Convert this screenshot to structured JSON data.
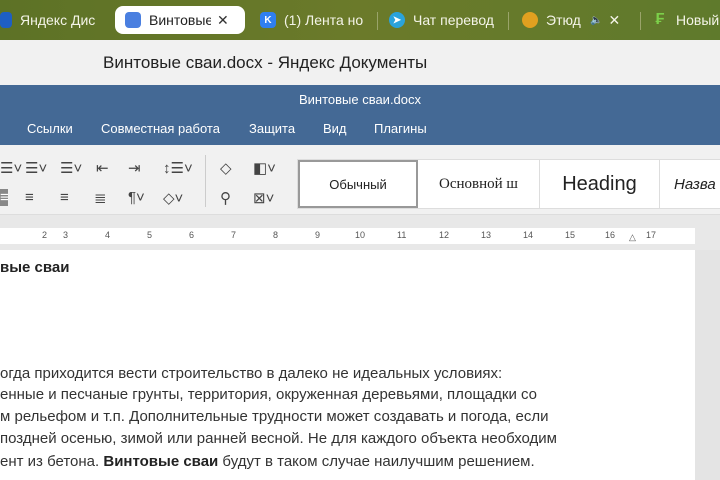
{
  "browser_tabs": [
    {
      "label": "Яндекс Дис",
      "icon": "yandex-disk-icon"
    },
    {
      "label": "Винтовые",
      "icon": "yandex-docs-icon",
      "active": true
    },
    {
      "label": "(1) Лента но",
      "icon": "vk-icon"
    },
    {
      "label": "Чат перевод",
      "icon": "telegram-icon"
    },
    {
      "label": "Этюд",
      "icon": "site-icon"
    },
    {
      "label": "Новый",
      "icon": "new-tab-icon"
    }
  ],
  "window_title": "Винтовые сваи.docx - Яндекс Документы",
  "header": {
    "doc_title": "Винтовые сваи.docx",
    "menu": [
      "Ссылки",
      "Совместная работа",
      "Защита",
      "Вид",
      "Плагины"
    ]
  },
  "styles": [
    "Обычный",
    "Основной ш",
    "Heading",
    "Назва"
  ],
  "ruler": [
    "2",
    "3",
    "4",
    "5",
    "6",
    "7",
    "8",
    "9",
    "10",
    "11",
    "12",
    "13",
    "14",
    "15",
    "16",
    "17"
  ],
  "document": {
    "heading": "вые сваи",
    "lines": [
      "огда приходится вести строительство в далеко не идеальных условиях:",
      "енные и песчаные грунты, территория, окруженная деревьями, площадки со",
      "м рельефом и т.п. Дополнительные трудности может создавать и погода, если",
      " поздней осенью, зимой или ранней весной. Не для каждого объекта необходим"
    ],
    "last_line": {
      "pre": "ент из бетона. ",
      "bold": "Винтовые сваи",
      "post": " будут в таком случае наилучшим решением."
    }
  }
}
